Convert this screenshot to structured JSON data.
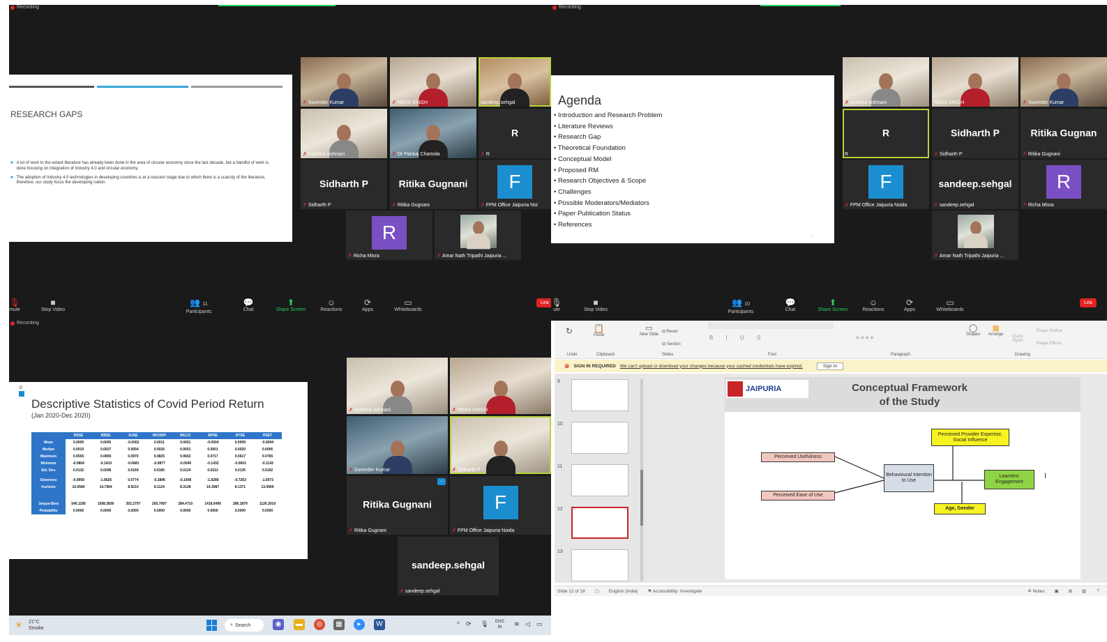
{
  "q1": {
    "recording": "Recording",
    "slide": {
      "title": "RESEARCH GAPS",
      "bullets": [
        "A lot of work in the extant literature has already been done in the area of circular economy since the last decade, but a handful of work is done focusing on integration of Industry 4.0 and circular economy.",
        "The adoption of Industry 4.0 technologies in developing countries is at a nascent stage due to which there is a scarcity of the literature, therefore, our study focus the developing nation."
      ]
    },
    "tiles": [
      {
        "name": "Surender Kumar"
      },
      {
        "name": "NIDHI SINGH"
      },
      {
        "name": "sandeep.sehgal"
      },
      {
        "name": "sushma vishnani"
      },
      {
        "name": "Dr Pankaj Chamola"
      },
      {
        "big": "R",
        "name": "R"
      },
      {
        "big": "Sidharth P",
        "name": "Sidharth P"
      },
      {
        "big": "Ritika Gugnani",
        "name": "Ritika Gugnani"
      },
      {
        "avatar": "F",
        "name": "FPM Office Jaipuria Noi"
      },
      {
        "avatar": "R",
        "name": "Richa Misra"
      },
      {
        "name": "Amar Nath Tripathi Jaipuria ..."
      }
    ],
    "toolbar": {
      "mute": "mute",
      "video": "Stop Video",
      "participants": "Participants",
      "participants_count": "11",
      "chat": "Chat",
      "share": "Share Screen",
      "reactions": "Reactions",
      "apps": "Apps",
      "whiteboards": "Whiteboards",
      "leave": "Lea"
    }
  },
  "q2": {
    "recording": "Recording",
    "slide": {
      "title": "Agenda",
      "items": [
        "Introduction and Research Problem",
        "Literature Reviews",
        "Research Gap",
        "Theoretical Foundation",
        "Conceptual Model",
        "Proposed RM",
        "Research Objectives & Scope",
        "Challenges",
        "Possible Moderators/Mediators",
        "Paper Publication Status",
        "References"
      ]
    },
    "tiles": [
      {
        "name": "sushma vishnani"
      },
      {
        "name": "NIDHI SINGH"
      },
      {
        "name": "Surender Kumar"
      },
      {
        "big": "R",
        "name": "R"
      },
      {
        "big": "Sidharth P",
        "name": "Sidharth P"
      },
      {
        "big": "Ritika Gugnan",
        "name": "Ritika Gugnani"
      },
      {
        "avatar": "F",
        "name": "FPM Office Jaipuria Noida"
      },
      {
        "big": "sandeep.sehgal",
        "name": "sandeep.sehgal"
      },
      {
        "avatar": "R",
        "name": "Richa Misra"
      },
      {
        "name": "Amar Nath Tripathi Jaipuria ..."
      }
    ],
    "toolbar": {
      "mute": "ute",
      "video": "Stop Video",
      "participants": "Participants",
      "participants_count": "10",
      "chat": "Chat",
      "share": "Share Screen",
      "reactions": "Reactions",
      "apps": "Apps",
      "whiteboards": "Whiteboards",
      "leave": "Lea"
    }
  },
  "q3": {
    "recording": "Recording",
    "slide": {
      "title": "Descriptive Statistics of Covid Period Return",
      "subtitle": "(Jan 2020-Dec 2020)",
      "columns": [
        "",
        "RSSE",
        "RBSE",
        "RJSE",
        "RKOSPI",
        "RKLCI",
        "RPSE",
        "RTSE",
        "RSET"
      ],
      "rows": [
        [
          "Mean",
          "0.0005",
          "0.0005",
          "-0.0002",
          "0.0011",
          "0.0001",
          "-0.0004",
          "0.0009",
          "-0.0004"
        ],
        [
          "Median",
          "0.0010",
          "0.0027",
          "0.0004",
          "0.0026",
          "0.0001",
          "0.0001",
          "0.0020",
          "0.0006"
        ],
        [
          "Maximum",
          "0.0555",
          "0.0859",
          "0.0970",
          "0.0825",
          "0.0663",
          "0.0717",
          "0.0617",
          "0.0765"
        ],
        [
          "Minimum",
          "-0.0804",
          "-0.1410",
          "-0.0681",
          "-0.0877",
          "-0.0540",
          "-0.1432",
          "-0.0601",
          "-0.1143"
        ],
        [
          "Std. Dev.",
          "0.0132",
          "0.0208",
          "0.0169",
          "0.0180",
          "0.0124",
          "0.0213",
          "0.0135",
          "0.0192"
        ],
        [
          "Skewness",
          "-0.9959",
          "-1.6626",
          "0.0774",
          "-0.2846",
          "-0.1608",
          "-1.8289",
          "-0.7263",
          "-1.5973"
        ],
        [
          "Kurtosis",
          "10.0584",
          "14.7964",
          "8.9210",
          "8.1124",
          "8.3128",
          "14.3087",
          "8.1371",
          "13.0969"
        ],
        [
          "Jarque-Bera",
          "540.1185",
          "1508.3830",
          "352.2797",
          "265.7087",
          "284.4710",
          "1418.5490",
          "286.1879",
          "1126.2010"
        ],
        [
          "Probability",
          "0.0000",
          "0.0000",
          "0.0000",
          "0.0000",
          "0.0000",
          "0.0000",
          "0.0000",
          "0.0000"
        ]
      ]
    },
    "tiles": [
      {
        "name": "sushma vishnani"
      },
      {
        "name": "NIDHI SINGH"
      },
      {
        "name": "Surender Kumar"
      },
      {
        "name": "Sidharth P"
      },
      {
        "big": "Ritika Gugnani",
        "name": "Ritika Gugnani"
      },
      {
        "avatar": "F",
        "name": "FPM Office Jaipuria Noida"
      },
      {
        "big": "sandeep.sehgal",
        "name": "sandeep.sehgal"
      }
    ],
    "more": "..."
  },
  "q4": {
    "ribbon": {
      "undo": "Undo",
      "paste": "Paste",
      "clipboard": "Clipboard",
      "new_slide": "New Slide",
      "reset": "Reset",
      "section": "Section",
      "slides": "Slides",
      "font": "Font",
      "paragraph": "Paragraph",
      "shapes": "Shapes",
      "arrange": "Arrange",
      "quick_styles": "Quick Styles",
      "shape_outline": "Shape Outline",
      "shape_effects": "Shape Effects",
      "drawing": "Drawing"
    },
    "warning": {
      "label": "SIGN IN REQUIRED",
      "message": "We can't upload or download your changes because your cached credentials have expired.",
      "button": "Sign In"
    },
    "thumbs": [
      "9",
      "10",
      "11",
      "12",
      "13"
    ],
    "slide": {
      "logo": "JAIPURIA",
      "title_line1": "Conceptual Framework",
      "title_line2": "of the Study",
      "box_pu": "Perceived Usefulness",
      "box_peou": "Perceived Ease of Use",
      "box_bi": "Behavioural Intention to Use",
      "box_ppe": "Perceived Provider Expertise, Social Influence",
      "box_le": "Learners' Engagement",
      "box_ag": "Age, Gender"
    },
    "status": {
      "slide": "Slide 12 of 18",
      "lang": "English (India)",
      "access": "Accessibility: Investigate",
      "notes": "Notes"
    }
  },
  "taskbar": {
    "temp": "21°C",
    "weather": "Smoke",
    "search": "Search",
    "lang1": "ENG",
    "lang2": "IN"
  },
  "colors": {
    "zoom_green": "#23d160",
    "active_speaker": "#b8d23a",
    "table_blue": "#2e75c8",
    "avatar_blue": "#1b8ed0",
    "avatar_purple": "#7b4fc4",
    "box_yellow": "#f7f321",
    "box_pink": "#f2c7bd",
    "box_green": "#8fd444"
  }
}
